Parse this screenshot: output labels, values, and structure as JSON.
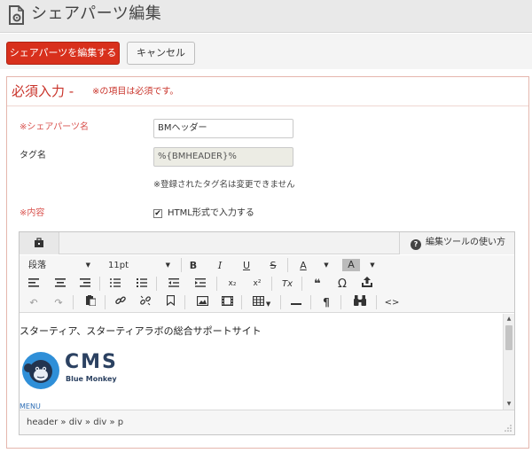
{
  "header": {
    "title": "シェアパーツ編集",
    "icon": "document-gear-icon"
  },
  "actions": {
    "save_label": "シェアパーツを編集する",
    "cancel_label": "キャンセル"
  },
  "section": {
    "title": "必須入力 -",
    "note": "※の項目は必須です。"
  },
  "form": {
    "name_label": "※シェアパーツ名",
    "name_value": "BMヘッダー",
    "tag_label": "タグ名",
    "tag_value": "%{BMHEADER}%",
    "tag_hint": "※登録されたタグ名は変更できません",
    "content_label": "※内容",
    "html_checkbox_label": "HTML形式で入力する",
    "html_checked": true
  },
  "editor": {
    "help_label": "編集ツールの使い方",
    "format_select": "段落",
    "size_select": "11pt",
    "content_text": "スターティア、スターティアラボの総合サポートサイト",
    "logo_text": "CMS",
    "logo_subtext": "Blue Monkey",
    "menu_text": "MENU",
    "element_path": "header » div » div » p",
    "toolbar_icons": {
      "bold": "B",
      "italic": "I",
      "underline": "U",
      "strikethrough": "S",
      "font_color": "A",
      "bg_color": "A",
      "subscript": "x₂",
      "superscript": "x²",
      "clear_format": "Tx",
      "blockquote": "❝",
      "special_char": "Ω",
      "code": "<>",
      "paragraph": "¶"
    }
  },
  "colors": {
    "accent": "#d8301c",
    "required": "#d9534f",
    "logo": "#2b4161"
  }
}
